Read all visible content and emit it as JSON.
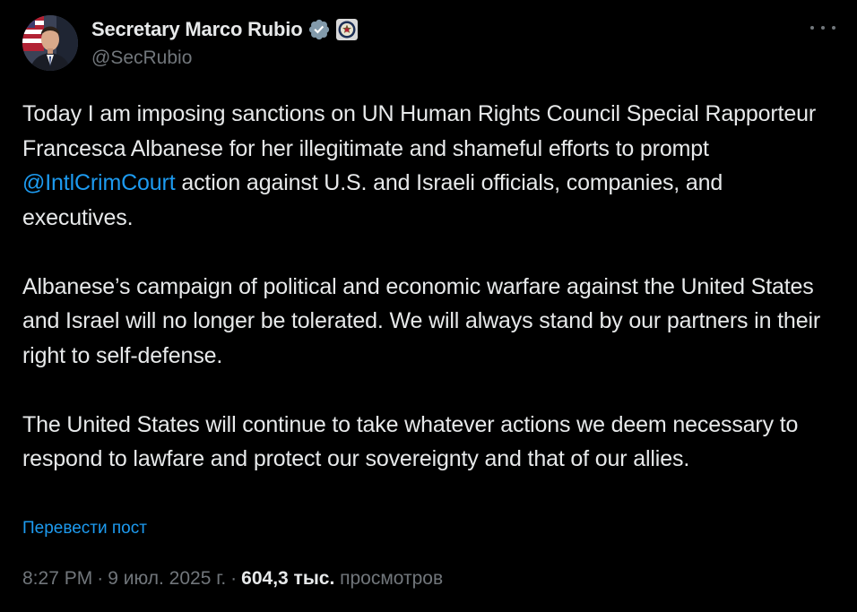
{
  "author": {
    "display_name": "Secretary Marco Rubio",
    "handle": "@SecRubio",
    "verified_icon": "verified-badge-icon",
    "affiliation_icon": "department-seal-icon",
    "avatar": "avatar-portrait"
  },
  "menu": {
    "more_icon": "more-options-icon"
  },
  "post": {
    "p1_before": "Today I am imposing sanctions on UN Human Rights Council Special Rapporteur Francesca Albanese for her illegitimate and shameful efforts to prompt ",
    "p1_mention": "@IntlCrimCourt",
    "p1_after": " action against U.S. and Israeli officials, companies, and executives.",
    "p2": "Albanese’s campaign of political and economic warfare against the United States and Israel will no longer be tolerated. We will always stand by our partners in their right to self-defense.",
    "p3": "The United States will continue to take whatever actions we deem necessary to respond to lawfare and protect our sovereignty and that of our allies."
  },
  "translate_label": "Перевести пост",
  "meta": {
    "time": "8:27 PM",
    "separator": "·",
    "date": "9 июл. 2025 г.",
    "views_count": "604,3 тыс.",
    "views_label": "просмотров"
  },
  "colors": {
    "background": "#000000",
    "text": "#e7e9ea",
    "secondary": "#71767b",
    "link": "#1d9bf0"
  }
}
